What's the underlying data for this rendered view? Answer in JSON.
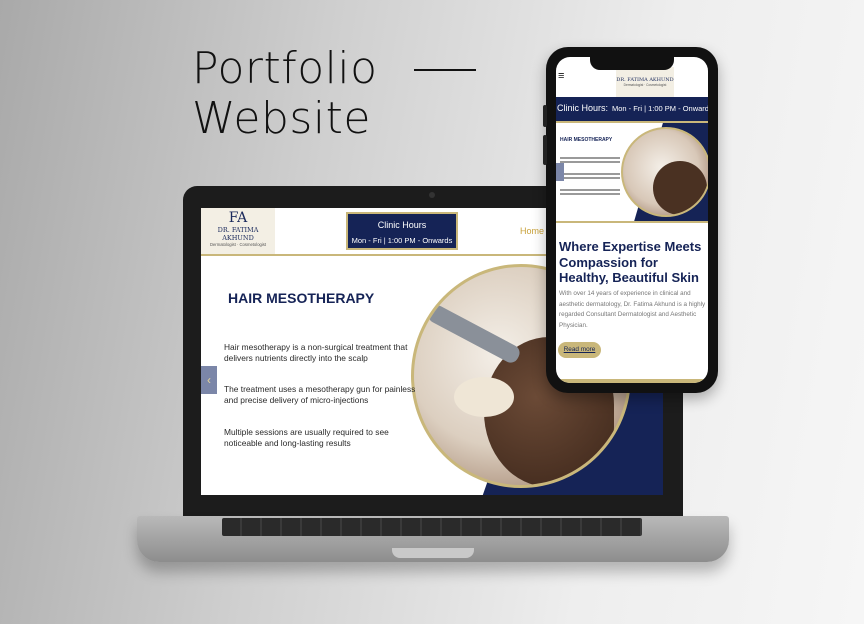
{
  "headline": {
    "line1": "Portfolio",
    "line2": "Website"
  },
  "desktop": {
    "logo": {
      "monogram": "FA",
      "name": "DR. FATIMA AKHUND",
      "subtitle": "Dermatologist · Cosmetologist"
    },
    "clinic_hours": {
      "title": "Clinic Hours",
      "value": "Mon - Fri | 1:00 PM - Onwards"
    },
    "nav": {
      "home": "Home"
    },
    "slide": {
      "title": "HAIR MESOTHERAPY",
      "points": [
        "Hair mesotherapy is a non-surgical treatment that delivers nutrients directly into the scalp",
        "The treatment uses a mesotherapy gun for painless and precise delivery of micro-injections",
        "Multiple sessions are usually required to see noticeable and long-lasting results"
      ],
      "prev_arrow": "‹"
    }
  },
  "mobile": {
    "menu_icon": "≡",
    "logo": {
      "name": "DR. FATIMA AKHUND",
      "subtitle": "Dermatologist · Cosmetologist"
    },
    "clinic_hours": {
      "title": "Clinic Hours:",
      "value": "Mon - Fri | 1:00 PM - Onward"
    },
    "slide_title": "HAIR MESOTHERAPY",
    "heading": "Where Expertise Meets Compassion for Healthy, Beautiful Skin",
    "paragraph": "With over 14 years of experience in clinical and aesthetic dermatology, Dr. Fatima Akhund is a highly regarded Consultant Dermatologist and Aesthetic Physician.",
    "read_more": "Read more"
  },
  "colors": {
    "navy": "#152356",
    "gold": "#c9b77a"
  }
}
